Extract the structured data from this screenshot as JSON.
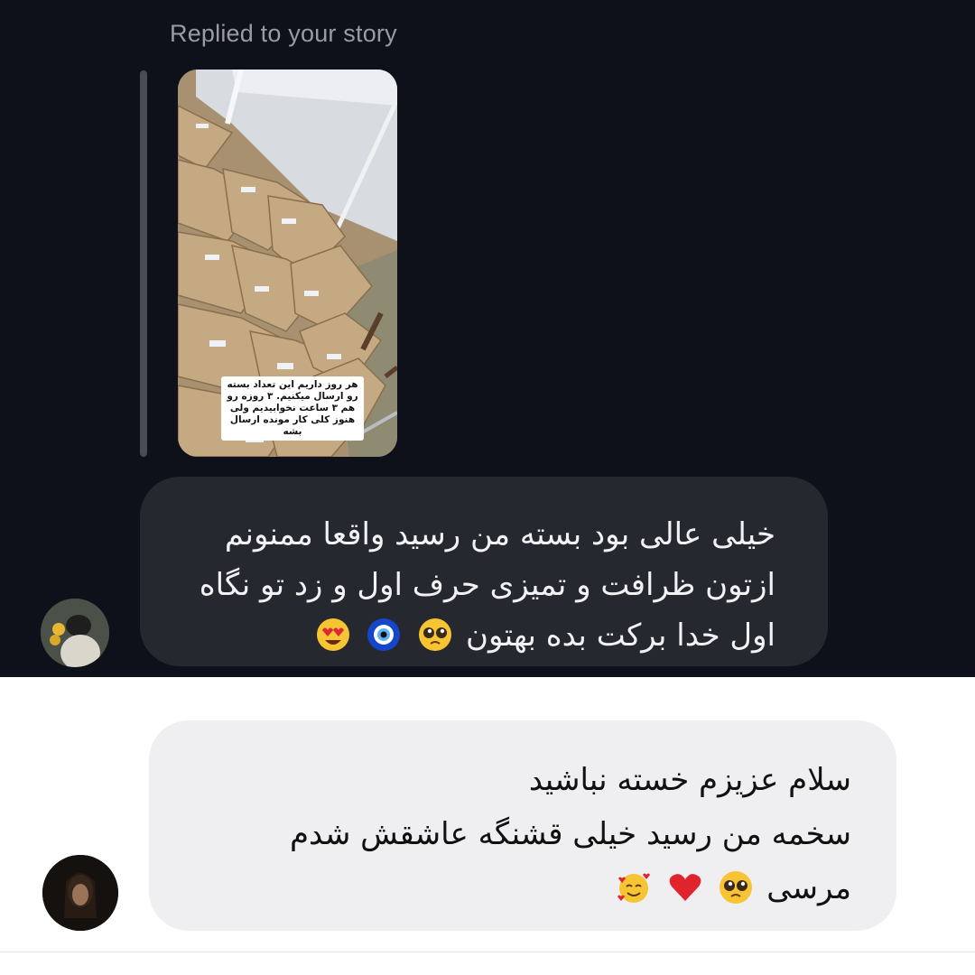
{
  "top_conversation": {
    "story_reply_label": "Replied to your story",
    "story_caption": "هر روز داریم این تعداد بسته رو ارسال میکنیم. ۳ روزه رو هم ۳ ساعت نخوابیدیم ولی هنوز کلی کار مونده ارسال بشه",
    "message_lines": [
      "خیلی عالی بود بسته من رسید واقعا ممنونم",
      "ازتون ظرافت و تمیزی حرف اول و زد تو نگاه",
      "اول خدا برکت بده بهتون"
    ],
    "message_emojis": [
      "pleading-face-icon",
      "nazar-amulet-icon",
      "heart-eyes-icon"
    ]
  },
  "bottom_conversation": {
    "message_lines": [
      "سلام عزیزم خسته نباشید",
      "سخمه من رسید خیلی قشنگه عاشقش شدم",
      "مرسی"
    ],
    "message_emojis": [
      "pleading-face-icon",
      "red-heart-icon",
      "smiling-face-with-hearts-icon"
    ]
  },
  "colors": {
    "dark_background": "#0f111a",
    "dark_bubble": "#262830",
    "light_bubble": "#efeff1",
    "muted_text": "#9a9ba3"
  }
}
